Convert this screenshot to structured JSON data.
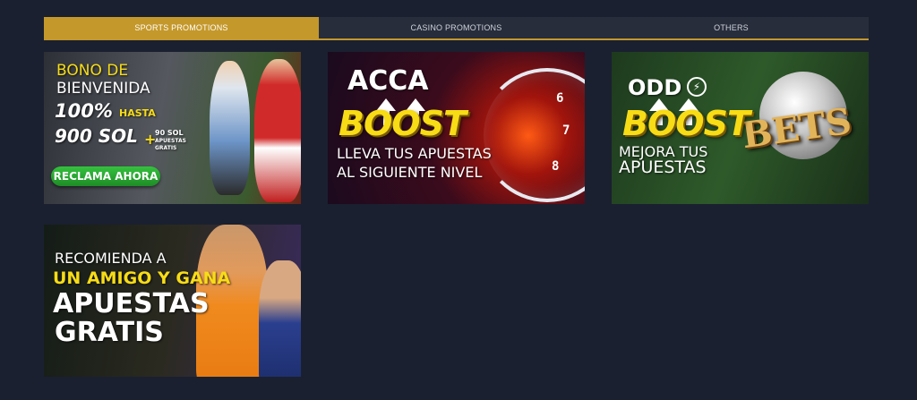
{
  "tabs": [
    {
      "label": "SPORTS PROMOTIONS",
      "active": true
    },
    {
      "label": "CASINO PROMOTIONS",
      "active": false
    },
    {
      "label": "OTHERS",
      "active": false
    }
  ],
  "colors": {
    "accent": "#c4982b",
    "background": "#1a2030",
    "tab_bg": "#272d3b",
    "boost_yellow": "#f7dc16",
    "cta_green": "#2aa834"
  },
  "promos": [
    {
      "line1": "BONO DE",
      "line2": "BIENVENIDA",
      "percent": "100%",
      "hasta": "HASTA",
      "amount": "900 SOL",
      "plus": "+",
      "extra_amount": "90 SOL",
      "extra_line2": "APUESTAS",
      "extra_line3": "GRATIS",
      "cta": "RECLAMA AHORA"
    },
    {
      "title": "ACCA",
      "boost": "BOOST",
      "line1": "LLEVA TUS APUESTAS",
      "line2": "AL SIGUIENTE NIVEL",
      "gauge_6": "6",
      "gauge_7": "7",
      "gauge_8": "8"
    },
    {
      "title": "ODD",
      "boost": "BOOST",
      "line1": "MEJORA TUS",
      "line2": "APUESTAS",
      "bets": "BETS"
    },
    {
      "line1": "RECOMIENDA A",
      "line2": "UN AMIGO Y GANA",
      "line3": "APUESTAS",
      "line4": "GRATIS"
    }
  ]
}
